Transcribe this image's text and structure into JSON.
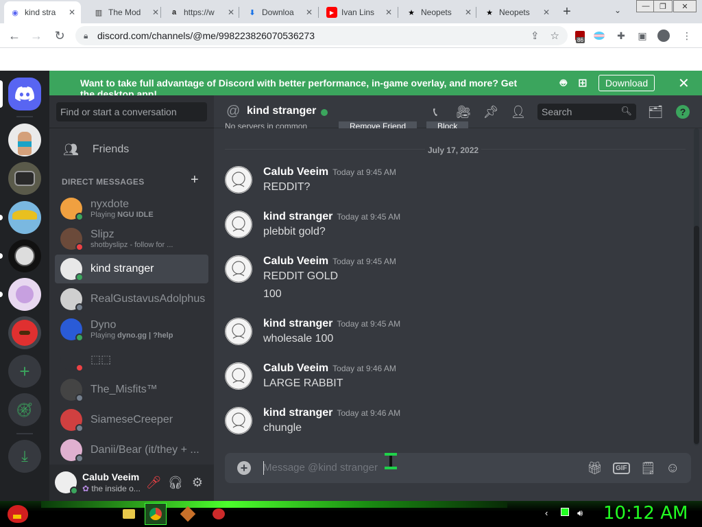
{
  "browser": {
    "tabs": [
      {
        "title": "kind stra",
        "favicon": "discord-favicon",
        "fav_color": "#5865f2",
        "active": true
      },
      {
        "title": "The Mod",
        "favicon": "chart-favicon",
        "fav_color": "#333333"
      },
      {
        "title": "https://w",
        "favicon": "amazon-favicon",
        "fav_color": "#222222"
      },
      {
        "title": "Downloa",
        "favicon": "download-favicon",
        "fav_color": "#1a73e8"
      },
      {
        "title": "Ivan Lins",
        "favicon": "youtube-favicon",
        "fav_color": "#ff0000"
      },
      {
        "title": "Neopets",
        "favicon": "star-favicon",
        "fav_color": "#000000"
      },
      {
        "title": "Neopets",
        "favicon": "star-favicon",
        "fav_color": "#000000"
      }
    ],
    "url": "discord.com/channels/@me/998223826070536273",
    "ext_badge": "86"
  },
  "banner": {
    "text": "Want to take full advantage of Discord with better performance, in-game overlay, and more? Get the desktop app!",
    "download_label": "Download"
  },
  "sidebar": {
    "search_placeholder": "Find or start a conversation",
    "friends_label": "Friends",
    "dm_header": "DIRECT MESSAGES",
    "dms": [
      {
        "name": "nyxdote",
        "sub_prefix": "Playing ",
        "sub_bold": "NGU IDLE",
        "status": "online",
        "av": "#f0a040"
      },
      {
        "name": "Slipz",
        "sub_prefix": "shotbyslipz - follow for ...",
        "sub_bold": "",
        "status": "dnd",
        "av": "#6b4a3a"
      },
      {
        "name": "kind stranger",
        "sub_prefix": "",
        "sub_bold": "",
        "status": "online",
        "av": "#e8e8e8",
        "active": true
      },
      {
        "name": "RealGustavusAdolphus",
        "sub_prefix": "",
        "sub_bold": "",
        "status": "offline",
        "av": "#cfcfcf"
      },
      {
        "name": "Dyno",
        "sub_prefix": "Playing ",
        "sub_bold": "dyno.gg | ?help",
        "status": "online",
        "av": "#2a5bd7"
      },
      {
        "name": "⬚⬚",
        "sub_prefix": "",
        "sub_bold": "",
        "status": "dnd",
        "av": "#2f3136"
      },
      {
        "name": "The_Misfits™",
        "sub_prefix": "",
        "sub_bold": "",
        "status": "offline",
        "av": "#444444"
      },
      {
        "name": "SiameseCreeper",
        "sub_prefix": "",
        "sub_bold": "",
        "status": "offline",
        "av": "#d04040"
      },
      {
        "name": "Danii/Bear (it/they + ...",
        "sub_prefix": "",
        "sub_bold": "",
        "status": "offline",
        "av": "#e0b0d0"
      }
    ]
  },
  "user": {
    "name": "Calub Veeim",
    "status": "the inside o..."
  },
  "chat": {
    "title": "kind stranger",
    "search_placeholder": "Search",
    "partial_text": "No servers in common",
    "partial_btn1": "Remove Friend",
    "partial_btn2": "Block",
    "date_divider": "July 17, 2022",
    "messages": [
      {
        "author": "Calub Veeim",
        "time": "Today at 9:45 AM",
        "lines": [
          "REDDIT?"
        ]
      },
      {
        "author": "kind stranger",
        "time": "Today at 9:45 AM",
        "lines": [
          "plebbit gold?"
        ]
      },
      {
        "author": "Calub Veeim",
        "time": "Today at 9:45 AM",
        "lines": [
          "REDDIT GOLD",
          "100"
        ]
      },
      {
        "author": "kind stranger",
        "time": "Today at 9:45 AM",
        "lines": [
          "wholesale 100"
        ]
      },
      {
        "author": "Calub Veeim",
        "time": "Today at 9:46 AM",
        "lines": [
          "LARGE RABBIT"
        ]
      },
      {
        "author": "kind stranger",
        "time": "Today at 9:46 AM",
        "lines": [
          "chungle"
        ]
      }
    ],
    "composer_placeholder": "Message @kind stranger",
    "gif_label": "GIF"
  },
  "taskbar": {
    "clock": "10:12 AM"
  },
  "colors": {
    "discord_blurple": "#5865f2",
    "discord_green": "#3ba55d",
    "taskbar_green": "#22ff22"
  }
}
